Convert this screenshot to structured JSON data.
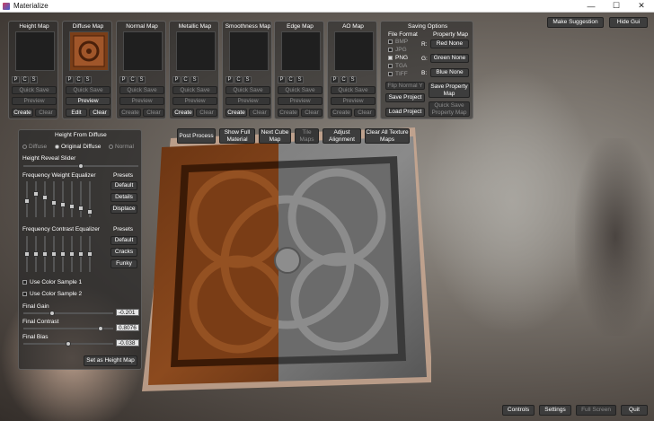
{
  "window": {
    "title": "Materialize",
    "minimize": "—",
    "maximize": "☐",
    "close": "✕"
  },
  "maps": [
    {
      "title": "Height Map",
      "quick_save": "Quick Save",
      "preview": "Preview",
      "create": "Create",
      "clear": "Clear"
    },
    {
      "title": "Diffuse Map",
      "quick_save": "Quick Save",
      "preview": "Preview",
      "create": "Edit",
      "clear": "Clear"
    },
    {
      "title": "Normal Map",
      "quick_save": "Quick Save",
      "preview": "Preview",
      "create": "Create",
      "clear": "Clear"
    },
    {
      "title": "Metallic Map",
      "quick_save": "Quick Save",
      "preview": "Preview",
      "create": "Create",
      "clear": "Clear"
    },
    {
      "title": "Smoothness Map",
      "quick_save": "Quick Save",
      "preview": "Preview",
      "create": "Create",
      "clear": "Clear"
    },
    {
      "title": "Edge Map",
      "quick_save": "Quick Save",
      "preview": "Preview",
      "create": "Create",
      "clear": "Clear"
    },
    {
      "title": "AO Map",
      "quick_save": "Quick Save",
      "preview": "Preview",
      "create": "Create",
      "clear": "Clear"
    }
  ],
  "pcs": [
    "P",
    "C",
    "S"
  ],
  "saving": {
    "title": "Saving Options",
    "file_format": "File Format",
    "property_map": "Property Map",
    "formats": [
      "BMP",
      "JPG",
      "PNG",
      "TGA",
      "TIFF"
    ],
    "selected_format": "PNG",
    "channels": [
      {
        "label": "R:",
        "value": "Red None"
      },
      {
        "label": "G:",
        "value": "Green None"
      },
      {
        "label": "B:",
        "value": "Blue None"
      }
    ],
    "flip_normal": "Flip Normal Y",
    "save_project": "Save Project",
    "load_project": "Load Project",
    "save_property": "Save Property Map",
    "quick_save_property": "Quick Save Property Map"
  },
  "top_right": {
    "suggest": "Make Suggestion",
    "hide": "Hide Gui"
  },
  "toolbar": {
    "post": "Post Process",
    "show_full": "Show Full Material",
    "next_cube": "Next Cube Map",
    "tile": "Tile Maps",
    "adjust": "Adjust Alignment",
    "clear_all": "Clear All Texture Maps"
  },
  "hfd": {
    "title": "Height From Diffuse",
    "radio_diffuse": "Diffuse",
    "radio_original": "Original Diffuse",
    "radio_normal": "Normal",
    "reveal": "Height Reveal Slider",
    "freq_weight": "Frequency Weight Equalizer",
    "presets": "Presets",
    "weight_presets": [
      "Default",
      "Details",
      "Displace"
    ],
    "freq_contrast": "Frequency Contrast Equalizer",
    "contrast_presets": [
      "Default",
      "Cracks",
      "Funky"
    ],
    "use_sample1": "Use Color Sample 1",
    "use_sample2": "Use Color Sample 2",
    "final_gain": "Final Gain",
    "gain_val": "-0.201",
    "final_contrast": "Final Contrast",
    "contrast_val": "0.8076",
    "final_bias": "Final Bias",
    "bias_val": "-0.038",
    "set_height": "Set as Height Map"
  },
  "bottom": {
    "controls": "Controls",
    "settings": "Settings",
    "full_screen": "Full Screen",
    "quit": "Quit"
  }
}
